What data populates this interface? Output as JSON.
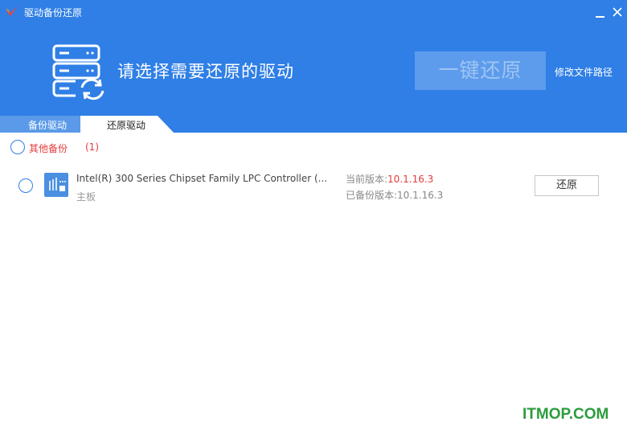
{
  "app": {
    "title": "驱动备份还原",
    "logo_icon": "red-check-logo-icon"
  },
  "window_controls": {
    "minimize_icon": "minimize-icon",
    "close_icon": "close-icon"
  },
  "header": {
    "heading": "请选择需要还原的驱动",
    "one_key_restore_label": "一键还原",
    "modify_path_label": "修改文件路径",
    "hero_icon": "server-restore-icon",
    "bg_color": "#2f7fe6"
  },
  "tabs": [
    {
      "label": "备份驱动",
      "active": false
    },
    {
      "label": "还原驱动",
      "active": true
    }
  ],
  "group": {
    "label": "其他备份",
    "count": "(1)",
    "label_color": "#e43c3c"
  },
  "drivers": [
    {
      "name": "Intel(R) 300 Series Chipset Family LPC Controller (...",
      "category": "主板",
      "current_version_label": "当前版本:",
      "current_version": "10.1.16.3",
      "backup_version_label": "已备份版本:",
      "backup_version": "10.1.16.3",
      "action_label": "还原",
      "icon": "chip-icon"
    }
  ],
  "watermark": "ITMOP.COM"
}
